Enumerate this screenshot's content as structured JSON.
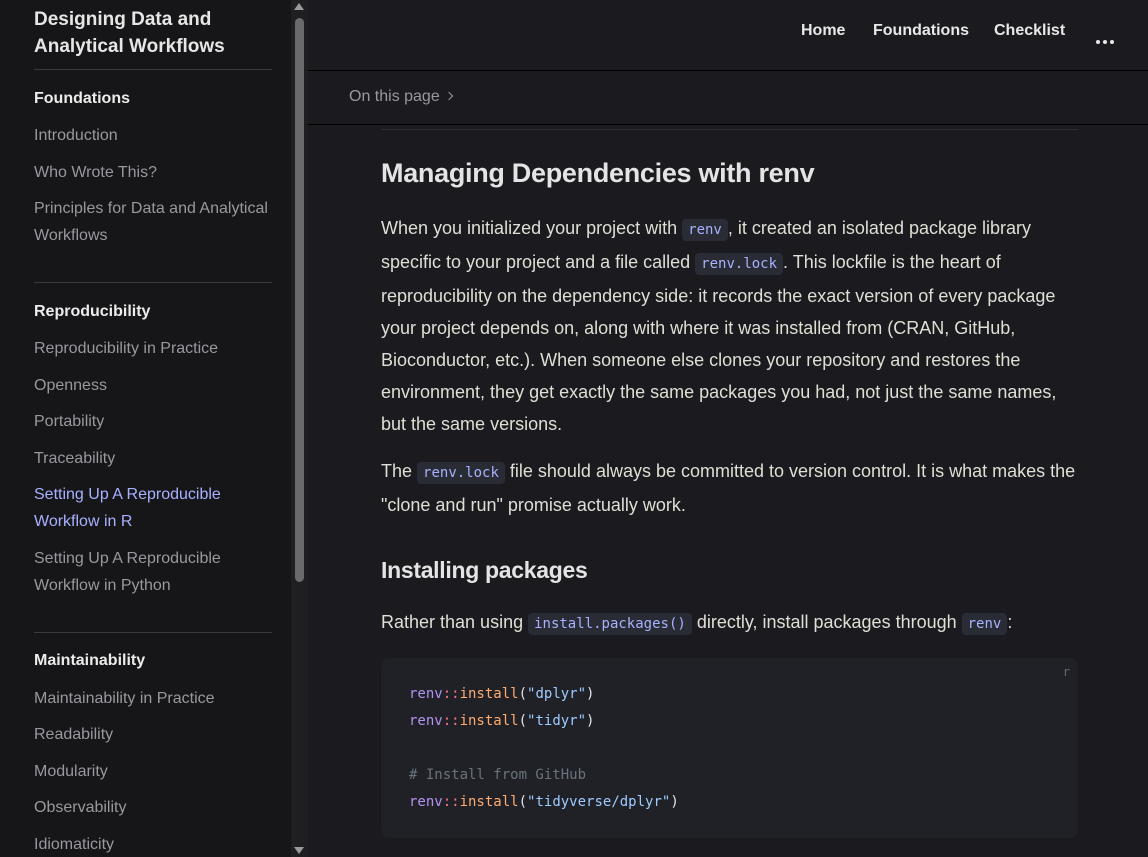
{
  "sidebar": {
    "title": "Designing Data and Analytical Workflows",
    "sections": [
      {
        "heading": "Foundations",
        "items": [
          {
            "label": "Introduction"
          },
          {
            "label": "Who Wrote This?"
          },
          {
            "label": "Principles for Data and Analytical Workflows"
          }
        ]
      },
      {
        "heading": "Reproducibility",
        "items": [
          {
            "label": "Reproducibility in Practice"
          },
          {
            "label": "Openness"
          },
          {
            "label": "Portability"
          },
          {
            "label": "Traceability"
          },
          {
            "label": "Setting Up A Reproducible Workflow in R",
            "active": true
          },
          {
            "label": "Setting Up A Reproducible Workflow in Python"
          }
        ]
      },
      {
        "heading": "Maintainability",
        "items": [
          {
            "label": "Maintainability in Practice"
          },
          {
            "label": "Readability"
          },
          {
            "label": "Modularity"
          },
          {
            "label": "Observability"
          },
          {
            "label": "Idiomaticity"
          }
        ]
      }
    ]
  },
  "topnav": {
    "links": [
      "Home",
      "Foundations",
      "Checklist"
    ],
    "more_icon": "ellipsis-icon"
  },
  "localnav": {
    "label": "On this page"
  },
  "article": {
    "heading1": "Managing Dependencies with renv",
    "para1": {
      "t1": "When you initialized your project with ",
      "c1": "renv",
      "t2": ", it created an isolated package library specific to your project and a file called ",
      "c2": "renv.lock",
      "t3": ". This lockfile is the heart of reproducibility on the dependency side: it records the exact version of every package your project depends on, along with where it was installed from (CRAN, GitHub, Bioconductor, etc.). When someone else clones your repository and restores the environment, they get exactly the same packages you had, not just the same names, but the same versions."
    },
    "para2": {
      "t1": "The ",
      "c1": "renv.lock",
      "t2": " file should always be committed to version control. It is what makes the \"clone and run\" promise actually work."
    },
    "heading2": "Installing packages",
    "para3": {
      "t1": "Rather than using ",
      "c1": "install.packages()",
      "t2": " directly, install packages through ",
      "c2": "renv",
      "t3": ":"
    },
    "code": {
      "lang": "r",
      "lines": [
        {
          "pkg": "renv",
          "op": "::",
          "fn": "install",
          "open": "(",
          "str": "\"dplyr\"",
          "close": ")"
        },
        {
          "pkg": "renv",
          "op": "::",
          "fn": "install",
          "open": "(",
          "str": "\"tidyr\"",
          "close": ")"
        },
        {
          "comment": "# Install from GitHub"
        },
        {
          "pkg": "renv",
          "op": "::",
          "fn": "install",
          "open": "(",
          "str": "\"tidyverse/dplyr\"",
          "close": ")"
        }
      ]
    }
  }
}
